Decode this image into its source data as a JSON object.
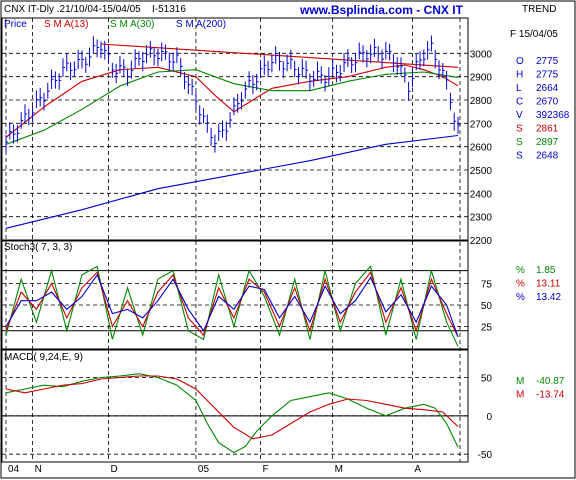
{
  "header": {
    "title": "CNX IT-Dly .21/10/04-15/04/05",
    "interval": "I-51316",
    "site": "www.Bsplindia.com - CNX IT",
    "trend": "TREND",
    "price_label": "Price",
    "sma13_label": "S M A(13)",
    "sma30_label": "S M A(30)",
    "sma200_label": "S M A(200)"
  },
  "info_panel": {
    "date": "F 15/04/05",
    "rows": [
      {
        "key": "O",
        "value": "2775",
        "color": "#0000cc"
      },
      {
        "key": "H",
        "value": "2775",
        "color": "#0000cc"
      },
      {
        "key": "L",
        "value": "2664",
        "color": "#0000cc"
      },
      {
        "key": "C",
        "value": "2670",
        "color": "#0000cc"
      },
      {
        "key": "V",
        "value": "392368",
        "color": "#0000cc"
      },
      {
        "key": "S",
        "value": "2861",
        "color": "#cc0000"
      },
      {
        "key": "S",
        "value": "2897",
        "color": "#008800"
      },
      {
        "key": "S",
        "value": "2648",
        "color": "#0000cc"
      }
    ]
  },
  "stoch": {
    "label": "Stoch3( 7, 3, 3)",
    "rows": [
      {
        "key": "%",
        "value": "1.85",
        "color": "#008800"
      },
      {
        "key": "%",
        "value": "13.11",
        "color": "#cc0000"
      },
      {
        "key": "%",
        "value": "13.42",
        "color": "#0000cc"
      }
    ]
  },
  "macd": {
    "label": "MACD( 9,24,E, 9)",
    "rows": [
      {
        "key": "M",
        "value": "-40.87",
        "color": "#008800"
      },
      {
        "key": "M",
        "value": "-13.74",
        "color": "#cc0000"
      }
    ]
  },
  "chart_data": [
    {
      "type": "line",
      "name": "price",
      "ylim": [
        2200,
        3100
      ],
      "yticks": [
        "3000",
        "2900",
        "2800",
        "2700",
        "2600",
        "2500",
        "2400",
        "2300",
        "2200"
      ],
      "ytick_values": [
        3000,
        2900,
        2800,
        2700,
        2600,
        2500,
        2400,
        2300,
        2200
      ],
      "xticks": [
        "04",
        "N",
        "D",
        "05",
        "F",
        "M",
        "A"
      ],
      "n_bars": 120,
      "xtick_bars": [
        0,
        7,
        27,
        50,
        67,
        86,
        107
      ],
      "series": [
        {
          "name": "S M A(13)",
          "color": "#cc0000",
          "x": [
            0,
            10,
            20,
            30,
            40,
            50,
            55,
            60,
            65,
            70,
            80,
            90,
            100,
            105,
            110,
            115,
            119
          ],
          "y": [
            2640,
            2770,
            2880,
            2930,
            2940,
            2900,
            2820,
            2750,
            2800,
            2850,
            2880,
            2900,
            2940,
            2950,
            2930,
            2900,
            2861
          ]
        },
        {
          "name": "S M A(30)",
          "color": "#008800",
          "x": [
            0,
            10,
            20,
            30,
            40,
            50,
            60,
            70,
            80,
            90,
            100,
            110,
            119
          ],
          "y": [
            2610,
            2670,
            2760,
            2860,
            2920,
            2930,
            2870,
            2840,
            2840,
            2880,
            2910,
            2920,
            2897
          ]
        },
        {
          "name": "S M A(200)",
          "color": "#0000cc",
          "x": [
            0,
            20,
            40,
            60,
            80,
            100,
            119
          ],
          "y": [
            2250,
            2330,
            2420,
            2480,
            2540,
            2610,
            2648
          ]
        },
        {
          "name": "",
          "color": "#cc0000",
          "x": [
            25,
            119
          ],
          "y": [
            3040,
            2940
          ]
        }
      ],
      "ohlc_anchor": {
        "x": [
          0,
          5,
          10,
          15,
          20,
          25,
          28,
          32,
          36,
          40,
          45,
          50,
          53,
          55,
          57,
          60,
          62,
          65,
          70,
          75,
          80,
          85,
          90,
          95,
          100,
          103,
          106,
          108,
          110,
          112,
          114,
          116,
          117,
          118,
          119
        ],
        "y": [
          2620,
          2720,
          2820,
          2930,
          2960,
          3040,
          2940,
          2920,
          2990,
          3000,
          2970,
          2800,
          2680,
          2630,
          2660,
          2750,
          2820,
          2880,
          2970,
          2950,
          2900,
          2900,
          2960,
          3000,
          3000,
          2960,
          2860,
          2940,
          3000,
          3020,
          2950,
          2870,
          2810,
          2720,
          2670
        ]
      }
    },
    {
      "type": "line",
      "name": "stochastic",
      "ylim": [
        0,
        100
      ],
      "yticks": [
        "75",
        "50",
        "25"
      ],
      "ytick_values": [
        75,
        50,
        25
      ],
      "hlines": [
        90,
        20
      ],
      "series": [
        {
          "name": "%K",
          "color": "#008800",
          "x": [
            0,
            4,
            8,
            12,
            16,
            20,
            24,
            28,
            32,
            36,
            40,
            44,
            48,
            52,
            56,
            60,
            64,
            68,
            72,
            76,
            80,
            84,
            88,
            92,
            96,
            100,
            104,
            108,
            112,
            116,
            119
          ],
          "y": [
            15,
            80,
            30,
            90,
            20,
            85,
            95,
            10,
            70,
            15,
            80,
            90,
            20,
            10,
            85,
            25,
            90,
            60,
            15,
            80,
            10,
            90,
            20,
            75,
            95,
            15,
            80,
            10,
            90,
            30,
            2
          ]
        },
        {
          "name": "%D",
          "color": "#cc0000",
          "x": [
            0,
            4,
            8,
            12,
            16,
            20,
            24,
            28,
            32,
            36,
            40,
            44,
            48,
            52,
            56,
            60,
            64,
            68,
            72,
            76,
            80,
            84,
            88,
            92,
            96,
            100,
            104,
            108,
            112,
            116,
            119
          ],
          "y": [
            20,
            65,
            45,
            75,
            35,
            70,
            88,
            25,
            55,
            25,
            65,
            85,
            35,
            15,
            70,
            35,
            80,
            65,
            25,
            70,
            20,
            80,
            30,
            65,
            88,
            30,
            70,
            20,
            80,
            40,
            13
          ]
        },
        {
          "name": "%",
          "color": "#0000cc",
          "x": [
            0,
            4,
            8,
            12,
            16,
            20,
            24,
            28,
            32,
            36,
            40,
            44,
            48,
            52,
            56,
            60,
            64,
            68,
            72,
            76,
            80,
            84,
            88,
            92,
            96,
            100,
            104,
            108,
            112,
            116,
            119
          ],
          "y": [
            25,
            55,
            55,
            65,
            45,
            60,
            85,
            40,
            45,
            35,
            55,
            80,
            45,
            20,
            60,
            45,
            72,
            68,
            35,
            60,
            30,
            72,
            40,
            55,
            82,
            42,
            62,
            30,
            72,
            50,
            13
          ]
        }
      ]
    },
    {
      "type": "line",
      "name": "macd",
      "ylim": [
        -55,
        65
      ],
      "yticks": [
        "50",
        "0",
        "-50"
      ],
      "ytick_values": [
        50,
        0,
        -50
      ],
      "hlines": [
        0
      ],
      "series": [
        {
          "name": "MACD",
          "color": "#008800",
          "x": [
            0,
            5,
            10,
            15,
            20,
            25,
            30,
            35,
            40,
            45,
            50,
            53,
            56,
            60,
            63,
            66,
            70,
            75,
            80,
            85,
            90,
            95,
            100,
            105,
            110,
            113,
            116,
            119
          ],
          "y": [
            30,
            35,
            40,
            38,
            45,
            50,
            52,
            55,
            50,
            40,
            20,
            -10,
            -35,
            -48,
            -40,
            -20,
            0,
            20,
            25,
            30,
            22,
            10,
            0,
            10,
            15,
            10,
            -10,
            -41
          ]
        },
        {
          "name": "Signal",
          "color": "#cc0000",
          "x": [
            0,
            5,
            10,
            15,
            20,
            25,
            30,
            35,
            40,
            45,
            50,
            55,
            60,
            65,
            70,
            75,
            80,
            85,
            90,
            95,
            100,
            105,
            110,
            115,
            119
          ],
          "y": [
            35,
            30,
            35,
            40,
            42,
            48,
            50,
            52,
            52,
            48,
            35,
            10,
            -15,
            -30,
            -25,
            -10,
            5,
            15,
            22,
            20,
            15,
            10,
            8,
            5,
            -14
          ]
        }
      ]
    }
  ]
}
